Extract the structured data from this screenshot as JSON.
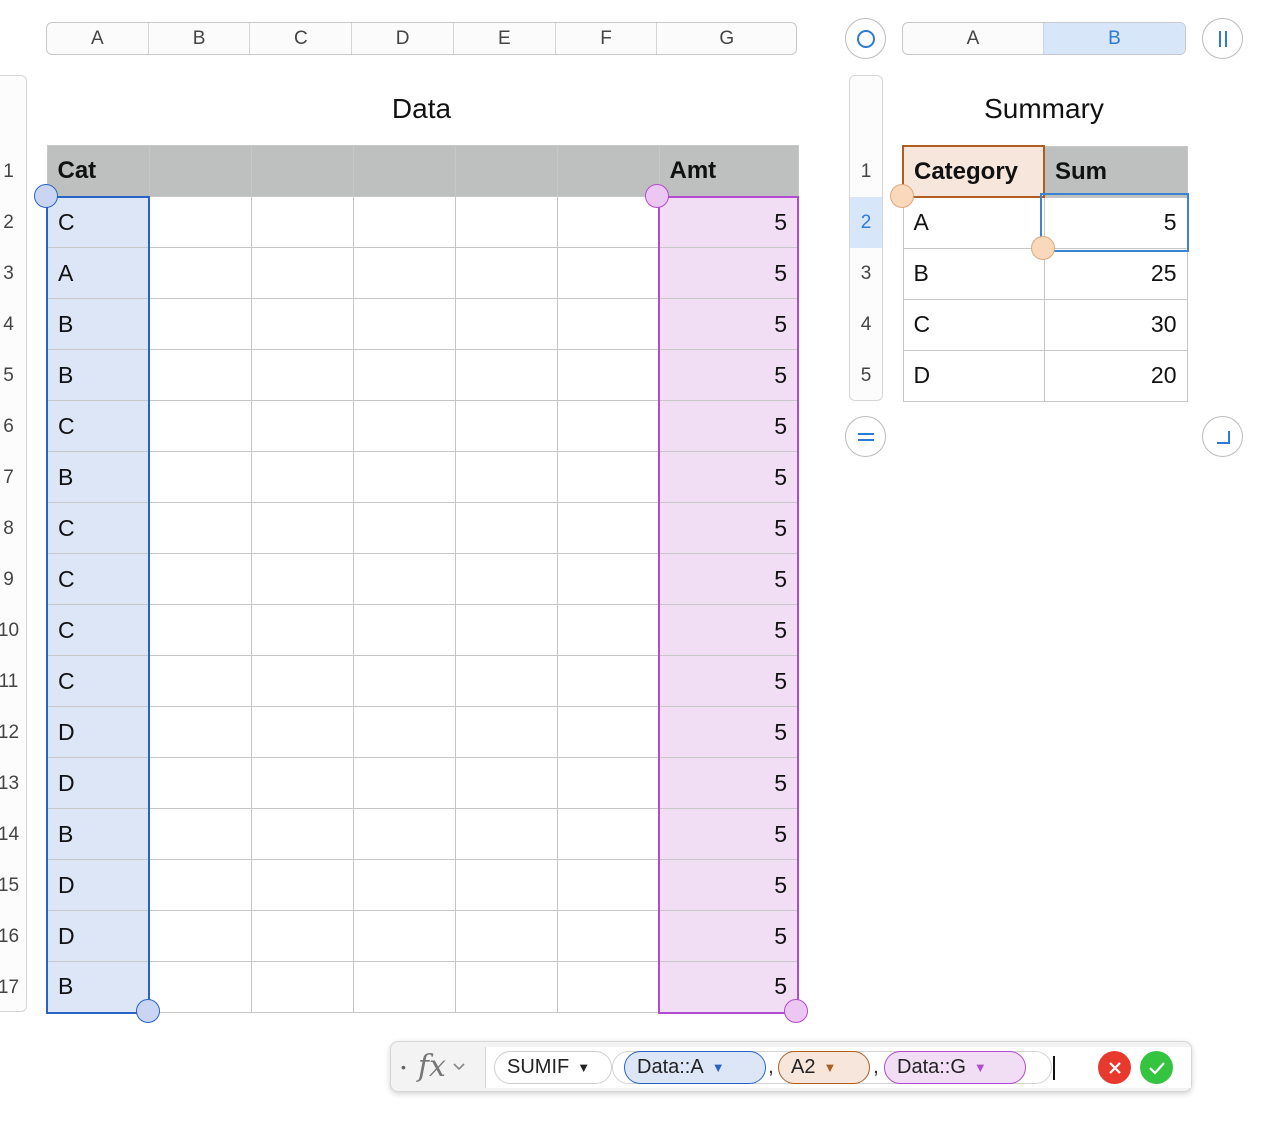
{
  "data_table": {
    "title": "Data",
    "columns": [
      "A",
      "B",
      "C",
      "D",
      "E",
      "F",
      "G"
    ],
    "header": [
      "Cat",
      "",
      "",
      "",
      "",
      "",
      "Amt"
    ],
    "row_numbers": [
      "1",
      "2",
      "3",
      "4",
      "5",
      "6",
      "7",
      "8",
      "9",
      "10",
      "11",
      "12",
      "13",
      "14",
      "15",
      "16",
      "17"
    ],
    "rows": [
      [
        "C",
        "",
        "",
        "",
        "",
        "",
        "5"
      ],
      [
        "A",
        "",
        "",
        "",
        "",
        "",
        "5"
      ],
      [
        "B",
        "",
        "",
        "",
        "",
        "",
        "5"
      ],
      [
        "B",
        "",
        "",
        "",
        "",
        "",
        "5"
      ],
      [
        "C",
        "",
        "",
        "",
        "",
        "",
        "5"
      ],
      [
        "B",
        "",
        "",
        "",
        "",
        "",
        "5"
      ],
      [
        "C",
        "",
        "",
        "",
        "",
        "",
        "5"
      ],
      [
        "C",
        "",
        "",
        "",
        "",
        "",
        "5"
      ],
      [
        "C",
        "",
        "",
        "",
        "",
        "",
        "5"
      ],
      [
        "C",
        "",
        "",
        "",
        "",
        "",
        "5"
      ],
      [
        "D",
        "",
        "",
        "",
        "",
        "",
        "5"
      ],
      [
        "D",
        "",
        "",
        "",
        "",
        "",
        "5"
      ],
      [
        "B",
        "",
        "",
        "",
        "",
        "",
        "5"
      ],
      [
        "D",
        "",
        "",
        "",
        "",
        "",
        "5"
      ],
      [
        "D",
        "",
        "",
        "",
        "",
        "",
        "5"
      ],
      [
        "B",
        "",
        "",
        "",
        "",
        "",
        "5"
      ]
    ]
  },
  "summary_table": {
    "title": "Summary",
    "columns": [
      "A",
      "B"
    ],
    "selected_column": "B",
    "header": [
      "Category",
      "Sum"
    ],
    "row_numbers": [
      "1",
      "2",
      "3",
      "4",
      "5"
    ],
    "selected_row": "2",
    "rows": [
      [
        "A",
        "5"
      ],
      [
        "B",
        "25"
      ],
      [
        "C",
        "30"
      ],
      [
        "D",
        "20"
      ]
    ]
  },
  "formula_bar": {
    "fx_label": "fx",
    "function_name": "SUMIF",
    "args": [
      "Data::A",
      "A2",
      "Data::G"
    ],
    "separator": ","
  },
  "colors": {
    "range_blue": "#dce6f7",
    "range_blue_border": "#2a63c6",
    "range_purple": "#f1def5",
    "range_purple_border": "#b24bcf",
    "ref_orange": "#f6e6dc",
    "ref_orange_border": "#b05d24",
    "header_gray": "#bebfbf",
    "accent_blue": "#2e7bd6",
    "cancel_red": "#e8392e",
    "accept_green": "#35c43f"
  }
}
